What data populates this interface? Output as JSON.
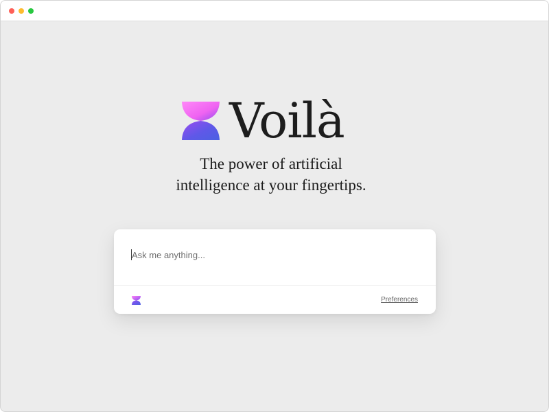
{
  "window": {
    "controls": [
      "close",
      "minimize",
      "zoom"
    ]
  },
  "brand": {
    "name": "Voilà",
    "logo_icon": "hourglass-logo-icon",
    "gradient_colors": [
      "#ff71f7",
      "#7c4dff",
      "#4d5be5"
    ]
  },
  "tagline": {
    "line1": "The power of artificial",
    "line2": "intelligence at your fingertips."
  },
  "prompt": {
    "value": "",
    "placeholder": "Ask me anything...",
    "preferences_label": "Preferences",
    "footer_icon": "hourglass-logo-icon"
  },
  "colors": {
    "background": "#ececec",
    "card": "#ffffff",
    "text": "#1d1d1d"
  }
}
